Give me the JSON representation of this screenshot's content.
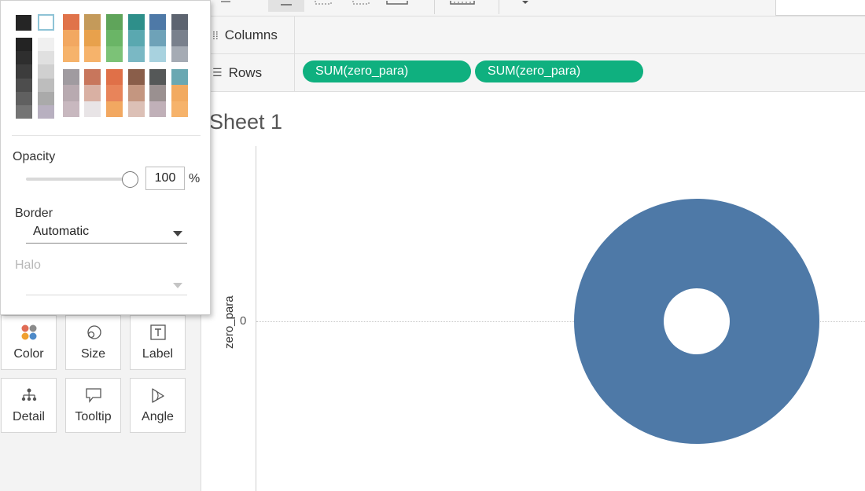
{
  "toolbar": {
    "icons": [
      "sort-icon",
      "fit-icon",
      "fit-width-icon",
      "fit-height-icon",
      "show-me-icon",
      "dropdown-icon"
    ]
  },
  "shelves": {
    "columns": {
      "label": "Columns",
      "icon": "columns-icon"
    },
    "rows": {
      "label": "Rows",
      "icon": "rows-icon",
      "pills": [
        "SUM(zero_para)",
        "SUM(zero_para)"
      ],
      "pill_color": "#0fb07f"
    }
  },
  "sheet": {
    "title": "Sheet 1",
    "axis_title": "zero_para",
    "axis_tick": "0"
  },
  "marks": {
    "buttons": [
      {
        "label": "Color",
        "icon": "color-icon"
      },
      {
        "label": "Size",
        "icon": "size-icon"
      },
      {
        "label": "Label",
        "icon": "label-icon"
      },
      {
        "label": "Detail",
        "icon": "detail-icon"
      },
      {
        "label": "Tooltip",
        "icon": "tooltip-icon"
      },
      {
        "label": "Angle",
        "icon": "angle-icon"
      }
    ]
  },
  "color_popup": {
    "opacity_label": "Opacity",
    "opacity_value": "100",
    "opacity_unit": "%",
    "opacity_level": 1.0,
    "border_label": "Border",
    "border_value": "Automatic",
    "halo_label": "Halo",
    "halo_value": ""
  },
  "colors": {
    "mark": "#4e79a7",
    "pill": "#0fb07f"
  },
  "chart_data": {
    "type": "pie",
    "title": "Sheet 1",
    "ylabel": "zero_para",
    "y_ticks": [
      "0"
    ],
    "marks": [
      {
        "y": 0,
        "color": "#4e79a7",
        "shape": "donut"
      }
    ]
  }
}
